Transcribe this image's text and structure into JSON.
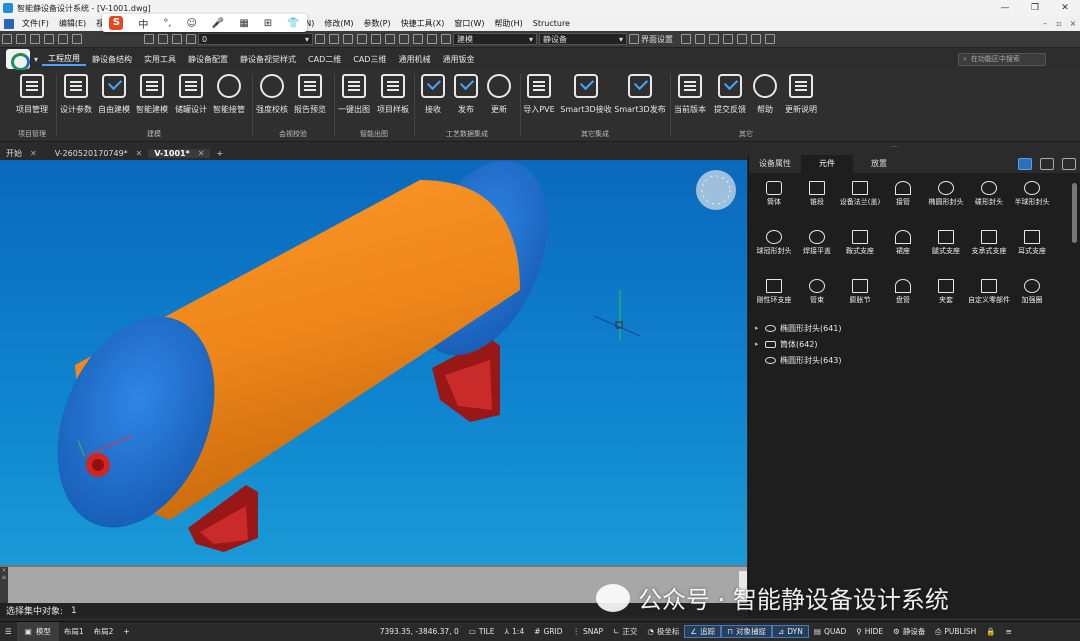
{
  "window": {
    "title": "智能静设备设计系统 - [V-1001.dwg]"
  },
  "menu": [
    "文件(F)",
    "编辑(E)",
    "视",
    "注(N)",
    "修改(M)",
    "参数(P)",
    "快捷工具(X)",
    "窗口(W)",
    "帮助(H)",
    "Structure"
  ],
  "ime_bar": {
    "logo": "S",
    "items": [
      "中",
      "°,",
      "☺",
      "🎤",
      "▦",
      "⊞",
      "👕"
    ]
  },
  "quickbar": {
    "layer_value": "0",
    "mode_select": "建模",
    "equip_select": "静设备",
    "ui_settings": "界面设置"
  },
  "tabs": [
    "工程应用",
    "静设备结构",
    "实用工具",
    "静设备配置",
    "静设备视觉样式",
    "CAD二维",
    "CAD三维",
    "通用机械",
    "通用钣金"
  ],
  "search_placeholder": "在功能区中搜索",
  "ribbon": {
    "buttons": [
      "项目管理",
      "设计参数",
      "自由建模",
      "智能建模",
      "储罐设计",
      "智能接管",
      "强度校核",
      "报告预览",
      "一键出图",
      "项目样板",
      "接收",
      "发布",
      "更新",
      "导入PVE",
      "Smart3D接收",
      "Smart3D发布",
      "当前版本",
      "提交反馈",
      "帮助",
      "更新说明"
    ],
    "groups": [
      "项目管理",
      "建模",
      "会视校验",
      "智能出图",
      "工艺数据集成",
      "其它集成",
      "其它"
    ]
  },
  "doc_tabs": [
    "开始",
    "V-260520170749*",
    "V-1001*"
  ],
  "panel": {
    "tabs": [
      "设备属性",
      "元件",
      "放置"
    ],
    "components": [
      "筒体",
      "锥段",
      "设备法兰(盖)",
      "接管",
      "椭圆形封头",
      "碟形封头",
      "半球形封头",
      "球冠形封头",
      "焊接平盖",
      "鞍式支座",
      "裙座",
      "腿式支座",
      "支承式支座",
      "耳式支座",
      "刚性环支座",
      "管束",
      "膨胀节",
      "盘管",
      "夹套",
      "自定义零部件",
      "加强圈"
    ],
    "tree": [
      {
        "label": "椭圆形封头(641)",
        "expand": "▸"
      },
      {
        "label": "筒体(642)",
        "expand": "▸"
      },
      {
        "label": "椭圆形封头(643)",
        "expand": ""
      }
    ]
  },
  "command": {
    "prompt": "选择集中对象:",
    "value": "1"
  },
  "status": {
    "layout_tabs": [
      "模型",
      "布局1",
      "布局2"
    ],
    "coords": "7393.35, -3846.37, 0",
    "items": [
      "TILE",
      "1:4",
      "GRID",
      "SNAP",
      "正交",
      "极坐标",
      "追踪",
      "对象捕捉",
      "DYN",
      "QUAD",
      "HIDE",
      "静设备",
      "PUBLISH"
    ]
  },
  "watermark": "公众号 · 智能静设备设计系统",
  "colors": {
    "shell": "#f28a1a",
    "head": "#1e74d6",
    "saddle": "#b51e1e",
    "accent": "#4aa3ff"
  }
}
